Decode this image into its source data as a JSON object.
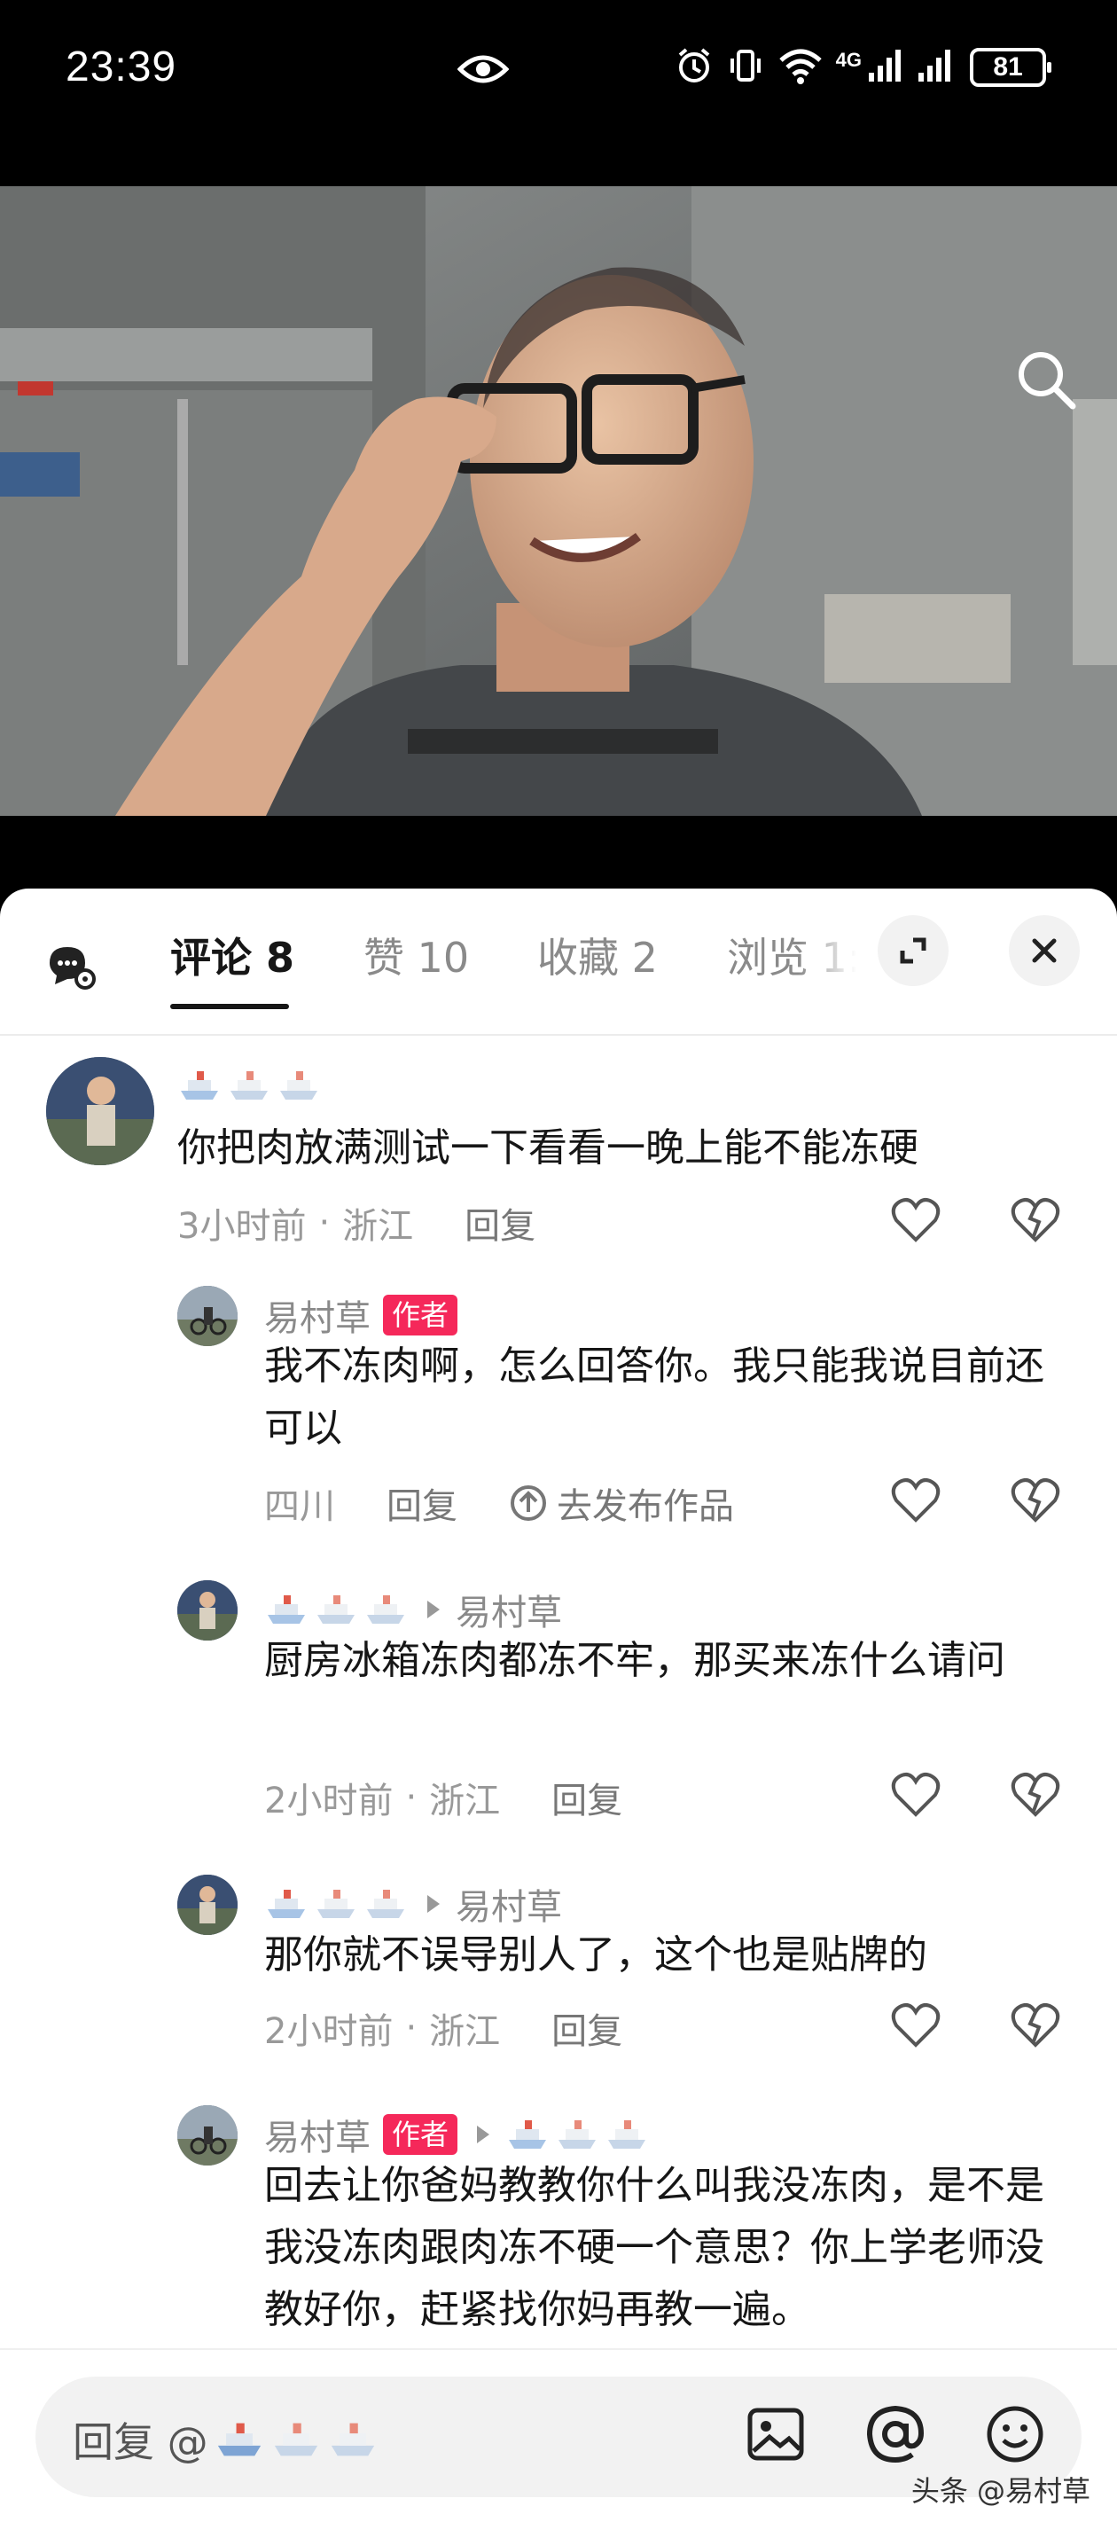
{
  "status_bar": {
    "time": "23:39",
    "battery": "81",
    "network": "4G"
  },
  "tabs": [
    {
      "label": "评论 8"
    },
    {
      "label": "赞 10"
    },
    {
      "label": "收藏 2"
    },
    {
      "label": "浏览 1:"
    }
  ],
  "comments": [
    {
      "text": "你把肉放满测试一下看看一晚上能不能冻硬",
      "time": "3小时前",
      "location": "浙江",
      "reply_label": "回复"
    },
    {
      "user": "易村草",
      "author_tag": "作者",
      "text": "我不冻肉啊，怎么回答你。我只能我说目前还可以",
      "location": "四川",
      "reply_label": "回复",
      "publish_label": "去发布作品"
    },
    {
      "reply_to": "易村草",
      "text": "厨房冰箱冻肉都冻不牢，那买来冻什么请问",
      "time": "2小时前",
      "location": "浙江",
      "reply_label": "回复"
    },
    {
      "reply_to": "易村草",
      "text": "那你就不误导别人了，这个也是贴牌的",
      "time": "2小时前",
      "location": "浙江",
      "reply_label": "回复"
    },
    {
      "user": "易村草",
      "author_tag": "作者",
      "text": "回去让你爸妈教教你什么叫我没冻肉，是不是我没冻肉跟肉冻不硬一个意思？你上学老师没教好你，赶紧找你妈再教一遍。"
    }
  ],
  "dot_separator": "·",
  "bottom_bar": {
    "reply_placeholder": "回复 @"
  },
  "watermark": "头条 @易村草",
  "colors": {
    "accent": "#f5285a",
    "text": "#161616",
    "muted": "#999999"
  }
}
